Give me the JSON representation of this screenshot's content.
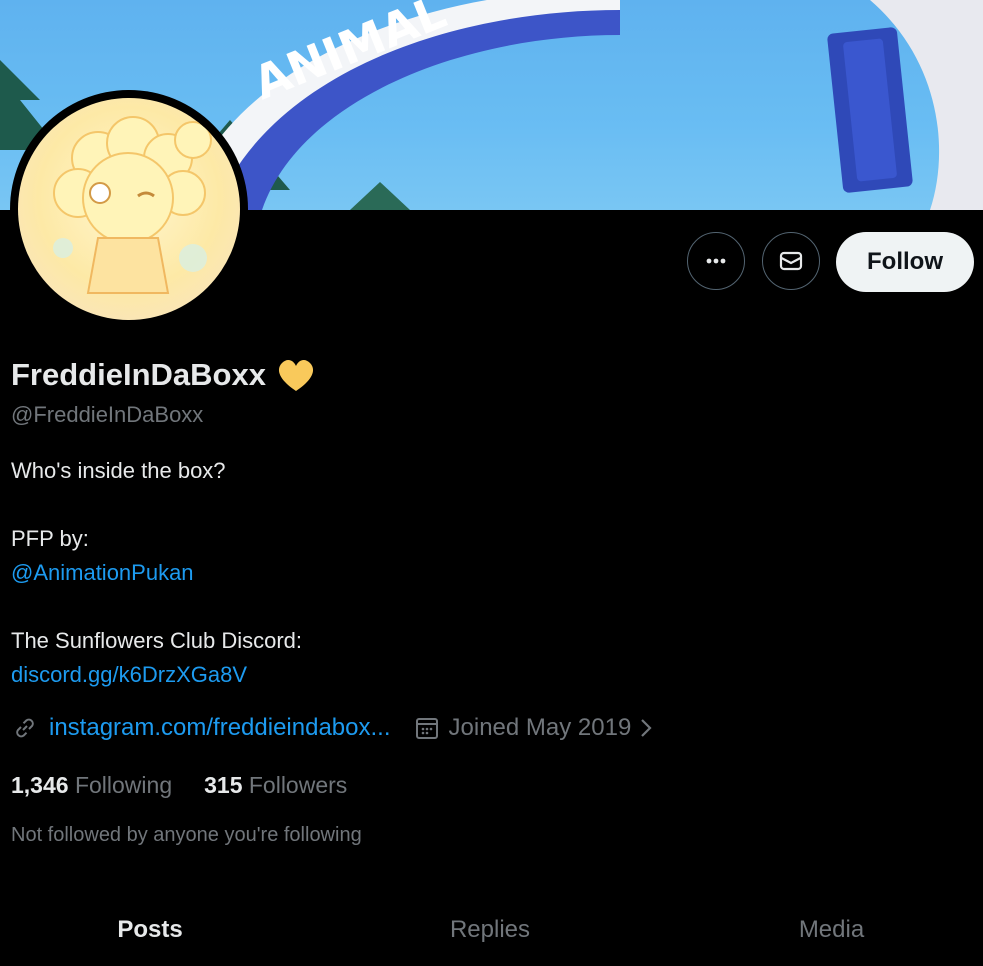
{
  "banner": {
    "arch_text": "ANIMAL"
  },
  "profile": {
    "display_name": "FreddieInDaBoxx",
    "handle": "@FreddieInDaBoxx",
    "bio_line1": "Who's inside the box?",
    "bio_line2": "PFP by:",
    "bio_mention": "@AnimationPukan",
    "bio_line3": "The Sunflowers Club Discord:",
    "bio_link": "discord.gg/k6DrzXGa8V",
    "website": "instagram.com/freddieindabox...",
    "joined": "Joined May 2019",
    "following_count": "1,346",
    "following_label": "Following",
    "followers_count": "315",
    "followers_label": "Followers",
    "not_followed_text": "Not followed by anyone you're following"
  },
  "actions": {
    "more_icon": "more-horizontal-icon",
    "message_icon": "envelope-icon",
    "follow_label": "Follow"
  },
  "tabs": [
    {
      "label": "Posts",
      "active": true
    },
    {
      "label": "Replies",
      "active": false
    },
    {
      "label": "Media",
      "active": false
    }
  ],
  "colors": {
    "link": "#1d9bf0",
    "heart": "#f9c95b",
    "muted": "#71767b"
  }
}
